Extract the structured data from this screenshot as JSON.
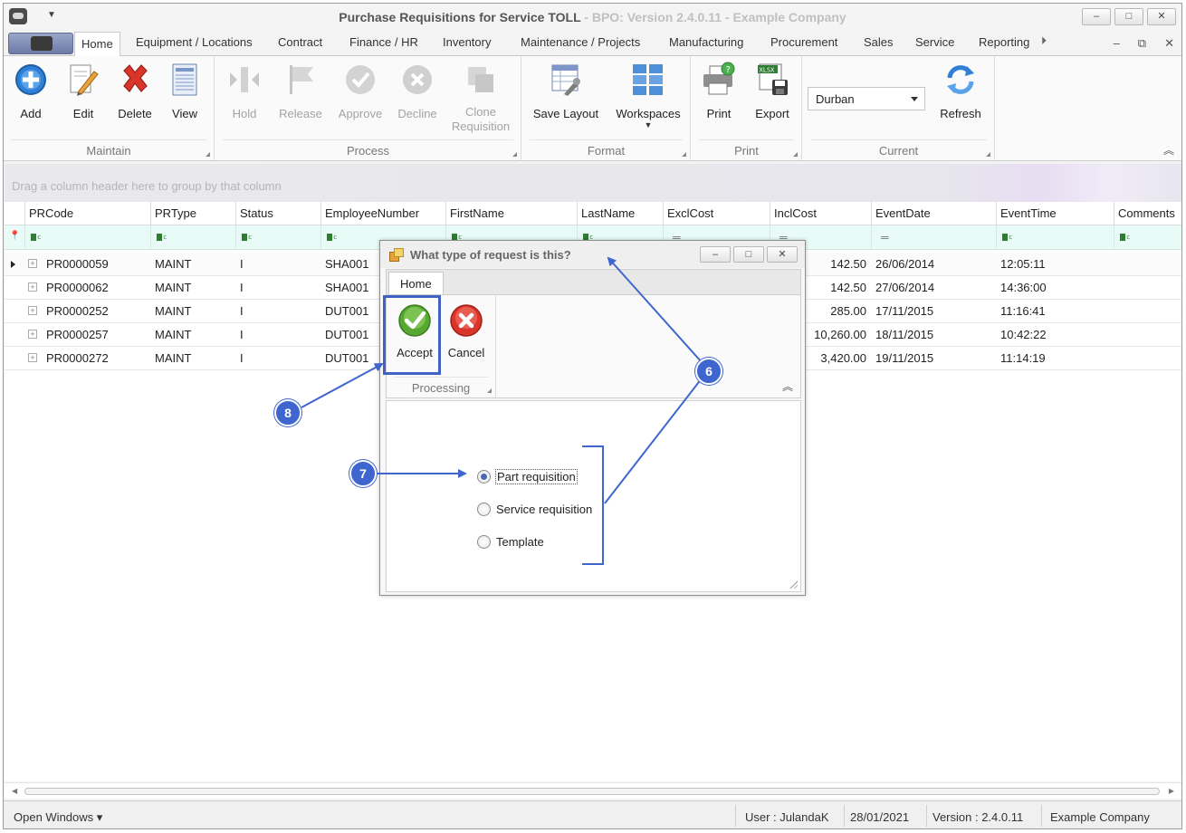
{
  "window": {
    "title_main": "Purchase Requisitions for Service TOLL",
    "title_sub": " - BPO: Version 2.4.0.11 - Example Company",
    "controls": [
      "–",
      "□",
      "✕"
    ]
  },
  "tabs": [
    "Home",
    "Equipment / Locations",
    "Contract",
    "Finance / HR",
    "Inventory",
    "Maintenance / Projects",
    "Manufacturing",
    "Procurement",
    "Sales",
    "Service",
    "Reporting"
  ],
  "mdi_controls": [
    "–",
    "⧉",
    "✕"
  ],
  "ribbon": {
    "groups": {
      "maintain": "Maintain",
      "process": "Process",
      "format": "Format",
      "print": "Print",
      "current": "Current"
    },
    "buttons": {
      "add": "Add",
      "edit": "Edit",
      "delete": "Delete",
      "view": "View",
      "hold": "Hold",
      "release": "Release",
      "approve": "Approve",
      "decline": "Decline",
      "clone": "Clone\nRequisition",
      "save_layout": "Save Layout",
      "workspaces": "Workspaces",
      "print": "Print",
      "export": "Export",
      "refresh": "Refresh"
    },
    "site_combo": "Durban",
    "export_badge": "XLSX"
  },
  "grid": {
    "group_hint": "Drag a column header here to group by that column",
    "columns": [
      "PRCode",
      "PRType",
      "Status",
      "EmployeeNumber",
      "FirstName",
      "LastName",
      "ExclCost",
      "InclCost",
      "EventDate",
      "EventTime",
      "Comments"
    ],
    "rows": [
      {
        "PRCode": "PR0000059",
        "PRType": "MAINT",
        "Status": "I",
        "EmployeeNumber": "SHA001",
        "InclCost": "142.50",
        "EventDate": "26/06/2014",
        "EventTime": "12:05:11"
      },
      {
        "PRCode": "PR0000062",
        "PRType": "MAINT",
        "Status": "I",
        "EmployeeNumber": "SHA001",
        "InclCost": "142.50",
        "EventDate": "27/06/2014",
        "EventTime": "14:36:00"
      },
      {
        "PRCode": "PR0000252",
        "PRType": "MAINT",
        "Status": "I",
        "EmployeeNumber": "DUT001",
        "InclCost": "285.00",
        "EventDate": "17/11/2015",
        "EventTime": "11:16:41"
      },
      {
        "PRCode": "PR0000257",
        "PRType": "MAINT",
        "Status": "I",
        "EmployeeNumber": "DUT001",
        "InclCost": "10,260.00",
        "EventDate": "18/11/2015",
        "EventTime": "10:42:22"
      },
      {
        "PRCode": "PR0000272",
        "PRType": "MAINT",
        "Status": "I",
        "EmployeeNumber": "DUT001",
        "InclCost": "3,420.00",
        "EventDate": "19/11/2015",
        "EventTime": "11:14:19"
      }
    ]
  },
  "statusbar": {
    "open_windows": "Open Windows ▾",
    "user": "User : JulandaK",
    "date": "28/01/2021",
    "version": "Version : 2.4.0.11",
    "company": "Example Company"
  },
  "dialog": {
    "title": "What type of request is this?",
    "tab": "Home",
    "accept": "Accept",
    "cancel": "Cancel",
    "group": "Processing",
    "options": [
      "Part requisition",
      "Service requisition",
      "Template"
    ],
    "selected_option": "Part requisition"
  },
  "annotations": [
    "6",
    "7",
    "8"
  ],
  "colors": {
    "accent": "#3f66cf",
    "filter_row": "#e9fbf7",
    "delete_red": "#d9362b",
    "add_blue": "#2f7fd6",
    "accept_green": "#57a832"
  }
}
